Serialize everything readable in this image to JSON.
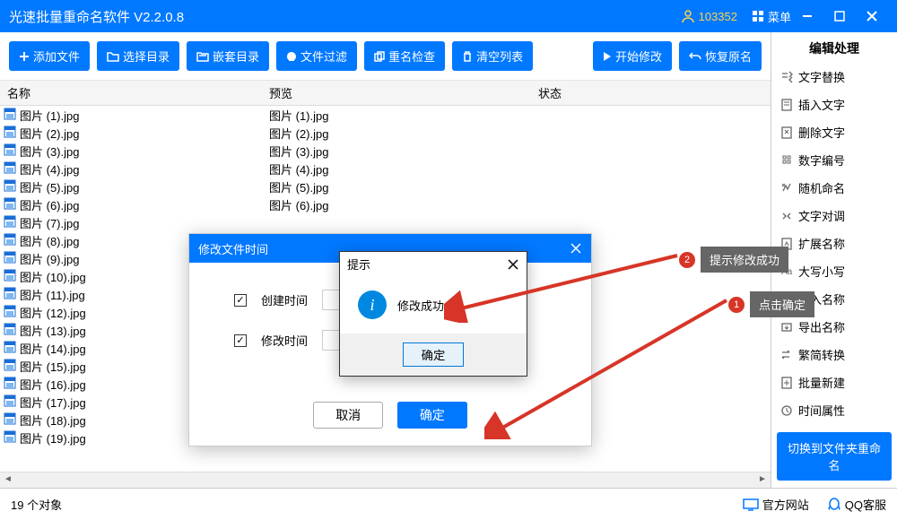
{
  "titlebar": {
    "title": "光速批量重命名软件 V2.2.0.8",
    "user_id": "103352",
    "menu": "菜单"
  },
  "toolbar": {
    "add_file": "添加文件",
    "select_dir": "选择目录",
    "nested_dir": "嵌套目录",
    "file_filter": "文件过滤",
    "rename_check": "重名检查",
    "clear_list": "清空列表",
    "start_modify": "开始修改",
    "restore_name": "恢复原名"
  },
  "columns": {
    "name": "名称",
    "preview": "预览",
    "status": "状态"
  },
  "files": [
    {
      "name": "图片 (1).jpg",
      "preview": "图片 (1).jpg"
    },
    {
      "name": "图片 (2).jpg",
      "preview": "图片 (2).jpg"
    },
    {
      "name": "图片 (3).jpg",
      "preview": "图片 (3).jpg"
    },
    {
      "name": "图片 (4).jpg",
      "preview": "图片 (4).jpg"
    },
    {
      "name": "图片 (5).jpg",
      "preview": "图片 (5).jpg"
    },
    {
      "name": "图片 (6).jpg",
      "preview": "图片 (6).jpg"
    },
    {
      "name": "图片 (7).jpg",
      "preview": ""
    },
    {
      "name": "图片 (8).jpg",
      "preview": ""
    },
    {
      "name": "图片 (9).jpg",
      "preview": ""
    },
    {
      "name": "图片 (10).jpg",
      "preview": ""
    },
    {
      "name": "图片 (11).jpg",
      "preview": ""
    },
    {
      "name": "图片 (12).jpg",
      "preview": ""
    },
    {
      "name": "图片 (13).jpg",
      "preview": ""
    },
    {
      "name": "图片 (14).jpg",
      "preview": ""
    },
    {
      "name": "图片 (15).jpg",
      "preview": ""
    },
    {
      "name": "图片 (16).jpg",
      "preview": ""
    },
    {
      "name": "图片 (17).jpg",
      "preview": ""
    },
    {
      "name": "图片 (18).jpg",
      "preview": ""
    },
    {
      "name": "图片 (19).jpg",
      "preview": ""
    }
  ],
  "sidebar": {
    "title": "编辑处理",
    "items": [
      "文字替换",
      "插入文字",
      "删除文字",
      "数字编号",
      "随机命名",
      "文字对调",
      "扩展名称",
      "大写小写",
      "导入名称",
      "导出名称",
      "繁简转换",
      "批量新建",
      "时间属性"
    ],
    "switch": "切换到文件夹重命名"
  },
  "status": {
    "count": "19",
    "objects": "个对象",
    "official_site": "官方网站",
    "qq_support": "QQ客服"
  },
  "modal1": {
    "title": "修改文件时间",
    "create_time": "创建时间",
    "modify_time": "修改时间",
    "cancel": "取消",
    "confirm": "确定"
  },
  "alert": {
    "title": "提示",
    "message": "修改成功",
    "ok": "确定"
  },
  "callouts": {
    "c1": "点击确定",
    "c2": "提示修改成功"
  }
}
